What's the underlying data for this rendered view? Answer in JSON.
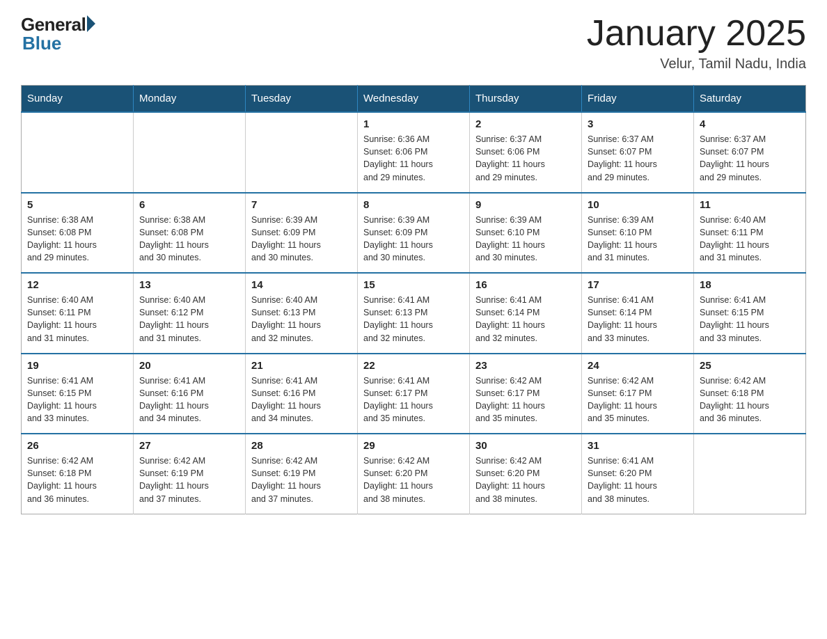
{
  "header": {
    "logo_general": "General",
    "logo_blue": "Blue",
    "title": "January 2025",
    "location": "Velur, Tamil Nadu, India"
  },
  "calendar": {
    "days_of_week": [
      "Sunday",
      "Monday",
      "Tuesday",
      "Wednesday",
      "Thursday",
      "Friday",
      "Saturday"
    ],
    "weeks": [
      [
        {
          "day": "",
          "info": ""
        },
        {
          "day": "",
          "info": ""
        },
        {
          "day": "",
          "info": ""
        },
        {
          "day": "1",
          "info": "Sunrise: 6:36 AM\nSunset: 6:06 PM\nDaylight: 11 hours\nand 29 minutes."
        },
        {
          "day": "2",
          "info": "Sunrise: 6:37 AM\nSunset: 6:06 PM\nDaylight: 11 hours\nand 29 minutes."
        },
        {
          "day": "3",
          "info": "Sunrise: 6:37 AM\nSunset: 6:07 PM\nDaylight: 11 hours\nand 29 minutes."
        },
        {
          "day": "4",
          "info": "Sunrise: 6:37 AM\nSunset: 6:07 PM\nDaylight: 11 hours\nand 29 minutes."
        }
      ],
      [
        {
          "day": "5",
          "info": "Sunrise: 6:38 AM\nSunset: 6:08 PM\nDaylight: 11 hours\nand 29 minutes."
        },
        {
          "day": "6",
          "info": "Sunrise: 6:38 AM\nSunset: 6:08 PM\nDaylight: 11 hours\nand 30 minutes."
        },
        {
          "day": "7",
          "info": "Sunrise: 6:39 AM\nSunset: 6:09 PM\nDaylight: 11 hours\nand 30 minutes."
        },
        {
          "day": "8",
          "info": "Sunrise: 6:39 AM\nSunset: 6:09 PM\nDaylight: 11 hours\nand 30 minutes."
        },
        {
          "day": "9",
          "info": "Sunrise: 6:39 AM\nSunset: 6:10 PM\nDaylight: 11 hours\nand 30 minutes."
        },
        {
          "day": "10",
          "info": "Sunrise: 6:39 AM\nSunset: 6:10 PM\nDaylight: 11 hours\nand 31 minutes."
        },
        {
          "day": "11",
          "info": "Sunrise: 6:40 AM\nSunset: 6:11 PM\nDaylight: 11 hours\nand 31 minutes."
        }
      ],
      [
        {
          "day": "12",
          "info": "Sunrise: 6:40 AM\nSunset: 6:11 PM\nDaylight: 11 hours\nand 31 minutes."
        },
        {
          "day": "13",
          "info": "Sunrise: 6:40 AM\nSunset: 6:12 PM\nDaylight: 11 hours\nand 31 minutes."
        },
        {
          "day": "14",
          "info": "Sunrise: 6:40 AM\nSunset: 6:13 PM\nDaylight: 11 hours\nand 32 minutes."
        },
        {
          "day": "15",
          "info": "Sunrise: 6:41 AM\nSunset: 6:13 PM\nDaylight: 11 hours\nand 32 minutes."
        },
        {
          "day": "16",
          "info": "Sunrise: 6:41 AM\nSunset: 6:14 PM\nDaylight: 11 hours\nand 32 minutes."
        },
        {
          "day": "17",
          "info": "Sunrise: 6:41 AM\nSunset: 6:14 PM\nDaylight: 11 hours\nand 33 minutes."
        },
        {
          "day": "18",
          "info": "Sunrise: 6:41 AM\nSunset: 6:15 PM\nDaylight: 11 hours\nand 33 minutes."
        }
      ],
      [
        {
          "day": "19",
          "info": "Sunrise: 6:41 AM\nSunset: 6:15 PM\nDaylight: 11 hours\nand 33 minutes."
        },
        {
          "day": "20",
          "info": "Sunrise: 6:41 AM\nSunset: 6:16 PM\nDaylight: 11 hours\nand 34 minutes."
        },
        {
          "day": "21",
          "info": "Sunrise: 6:41 AM\nSunset: 6:16 PM\nDaylight: 11 hours\nand 34 minutes."
        },
        {
          "day": "22",
          "info": "Sunrise: 6:41 AM\nSunset: 6:17 PM\nDaylight: 11 hours\nand 35 minutes."
        },
        {
          "day": "23",
          "info": "Sunrise: 6:42 AM\nSunset: 6:17 PM\nDaylight: 11 hours\nand 35 minutes."
        },
        {
          "day": "24",
          "info": "Sunrise: 6:42 AM\nSunset: 6:17 PM\nDaylight: 11 hours\nand 35 minutes."
        },
        {
          "day": "25",
          "info": "Sunrise: 6:42 AM\nSunset: 6:18 PM\nDaylight: 11 hours\nand 36 minutes."
        }
      ],
      [
        {
          "day": "26",
          "info": "Sunrise: 6:42 AM\nSunset: 6:18 PM\nDaylight: 11 hours\nand 36 minutes."
        },
        {
          "day": "27",
          "info": "Sunrise: 6:42 AM\nSunset: 6:19 PM\nDaylight: 11 hours\nand 37 minutes."
        },
        {
          "day": "28",
          "info": "Sunrise: 6:42 AM\nSunset: 6:19 PM\nDaylight: 11 hours\nand 37 minutes."
        },
        {
          "day": "29",
          "info": "Sunrise: 6:42 AM\nSunset: 6:20 PM\nDaylight: 11 hours\nand 38 minutes."
        },
        {
          "day": "30",
          "info": "Sunrise: 6:42 AM\nSunset: 6:20 PM\nDaylight: 11 hours\nand 38 minutes."
        },
        {
          "day": "31",
          "info": "Sunrise: 6:41 AM\nSunset: 6:20 PM\nDaylight: 11 hours\nand 38 minutes."
        },
        {
          "day": "",
          "info": ""
        }
      ]
    ]
  }
}
